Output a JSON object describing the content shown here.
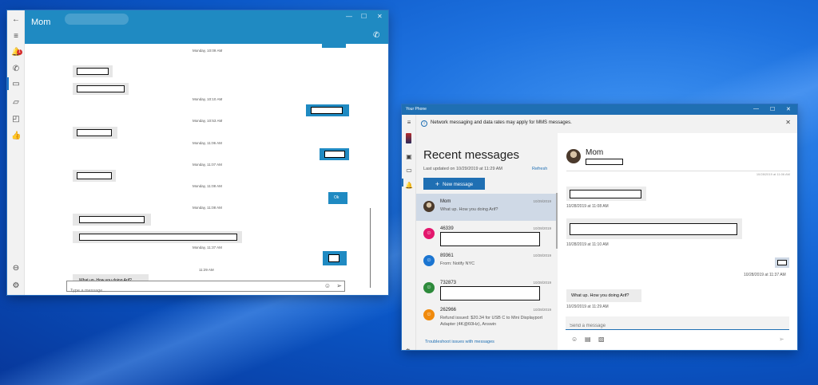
{
  "left_window": {
    "title": "Mom",
    "window_controls": [
      "—",
      "☐",
      "✕"
    ],
    "badge_count": "1",
    "messages": [
      {
        "type": "timestamp",
        "text": "Monday, 10:09 AM"
      },
      {
        "type": "timestamp",
        "text": "Monday, 10:10 AM"
      },
      {
        "type": "timestamp",
        "text": "Monday, 10:53 AM"
      },
      {
        "type": "timestamp",
        "text": "Monday, 11:06 AM"
      },
      {
        "type": "timestamp",
        "text": "Monday, 11:07 AM"
      },
      {
        "type": "timestamp",
        "text": "Monday, 11:08 AM"
      },
      {
        "type": "timestamp",
        "text": "Monday, 11:08 AM"
      },
      {
        "type": "timestamp",
        "text": "Monday, 11:37 AM"
      },
      {
        "type": "timestamp",
        "text": "11:29 AM"
      }
    ],
    "outgoing_ok": "Ok",
    "incoming_text": "What up.  How you doing Arif?",
    "input_placeholder": "Type a message..."
  },
  "right_window": {
    "title": "Your Phone",
    "window_controls": [
      "—",
      "☐",
      "✕"
    ],
    "banner_text": "Network messaging and data rates may apply for MMS messages.",
    "list": {
      "heading": "Recent messages",
      "last_updated": "Last updated on 10/29/2019 at 11:29 AM",
      "refresh": "Refresh",
      "new_message": "New message",
      "conversations": [
        {
          "name": "Mom",
          "date": "10/29/2019",
          "preview": "What up.  How you doing Arif?",
          "avatar_color": "#6b5a4a"
        },
        {
          "name": "46339",
          "date": "10/28/2019",
          "preview": "",
          "avatar_color": "#e3176d"
        },
        {
          "name": "89361",
          "date": "10/28/2019",
          "preview": "From: Notify NYC",
          "avatar_color": "#1b75d1"
        },
        {
          "name": "732873",
          "date": "10/28/2019",
          "preview": "",
          "avatar_color": "#2d8a3b"
        },
        {
          "name": "262966",
          "date": "10/28/2019",
          "preview": "Refund issued: $20.34 for USB C to Mini Displayport Adapter (4K@60Hz), Answin",
          "avatar_color": "#f08a0c"
        }
      ],
      "troubleshoot": "Troubleshoot issues with messages"
    },
    "conversation": {
      "contact_name": "Mom",
      "top_timestamp": "10/28/2019 at 11:06 AM",
      "ts1": "10/28/2019 at 11:08 AM",
      "ts2": "10/28/2019 at 11:10 AM",
      "ts3": "10/28/2019 at 11:37 AM",
      "incoming_text": "What up.  How you doing Arif?",
      "ts4": "10/29/2019 at 11:29 AM",
      "input_placeholder": "Send a message"
    }
  }
}
